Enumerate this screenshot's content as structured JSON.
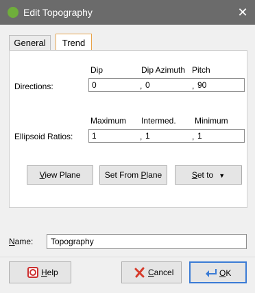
{
  "window": {
    "title": "Edit Topography",
    "close_glyph": "✕"
  },
  "tabs": [
    {
      "label": "General",
      "active": false
    },
    {
      "label": "Trend",
      "active": true
    }
  ],
  "directions": {
    "headers": {
      "dip": "Dip",
      "dip_azimuth": "Dip Azimuth",
      "pitch": "Pitch"
    },
    "label": "Directions:",
    "values": [
      "0",
      "0",
      "90"
    ]
  },
  "ellipsoid": {
    "headers": {
      "maximum": "Maximum",
      "intermed": "Intermed.",
      "minimum": "Minimum"
    },
    "label": "Ellipsoid Ratios:",
    "values": [
      "1",
      "1",
      "1"
    ]
  },
  "separator": ",",
  "buttons": {
    "view_plane": {
      "accel": "V",
      "rest": "iew Plane"
    },
    "set_from_plane": {
      "pre": "Set From ",
      "accel": "P",
      "rest": "lane"
    },
    "set_to": {
      "accel": "S",
      "rest": "et to",
      "caret": "▼"
    }
  },
  "name": {
    "accel": "N",
    "rest": "ame:",
    "value": "Topography"
  },
  "dialog_buttons": {
    "help": {
      "accel": "H",
      "rest": "elp",
      "icon": "help-icon"
    },
    "cancel": {
      "accel": "C",
      "rest": "ancel",
      "icon": "cancel-x-icon"
    },
    "ok": {
      "accel": "O",
      "rest": "K",
      "icon": "ok-arrow-icon"
    }
  },
  "colors": {
    "titlebar": "#6b6b6b",
    "active_tab_border": "#e8a34a",
    "default_button_border": "#3a7bd5",
    "app_icon": "#6fae3b",
    "cancel_icon": "#d63b2b",
    "help_icon": "#cc2f2f"
  }
}
